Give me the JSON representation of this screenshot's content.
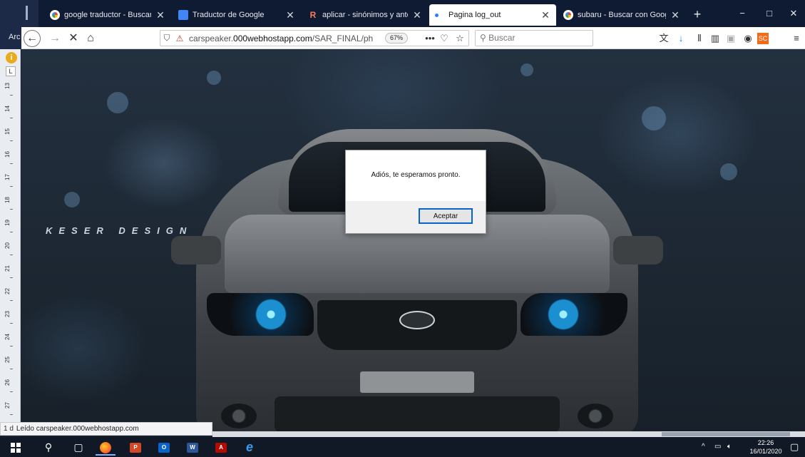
{
  "browser": {
    "tabs": [
      {
        "title": "google traductor - Buscar con Google",
        "favicon": "google-icon"
      },
      {
        "title": "Traductor de Google",
        "favicon": "translate-icon"
      },
      {
        "title": "aplicar - sinónimos y antónimos",
        "favicon": "wordreference-icon"
      },
      {
        "title": "Pagina log_out",
        "favicon": "loading-dot-icon",
        "active": true
      },
      {
        "title": "subaru - Buscar con Google",
        "favicon": "google-icon"
      }
    ],
    "new_tab": "+",
    "window_controls": {
      "minimize": "−",
      "maximize": "□",
      "close": "✕"
    },
    "left_pane_label": "Arc",
    "url_host": "carspeaker.000webhostapp.com",
    "url_prefix": "carspeaker.",
    "url_main": "000webhostapp.com",
    "url_path": "/SAR_FINAL/ph",
    "zoom": "67%",
    "search_placeholder": "Buscar",
    "more_actions": "•••"
  },
  "ruler": {
    "l_label": "L",
    "info_badge": "i",
    "numbers": [
      "13",
      "14",
      "15",
      "16",
      "17",
      "18",
      "19",
      "20",
      "21",
      "22",
      "23",
      "24",
      "25",
      "26",
      "27"
    ]
  },
  "page": {
    "brand": "KESER DESIGN"
  },
  "dialog": {
    "message": "Adiós, te esperamos pronto.",
    "ok_label": "Aceptar"
  },
  "status": {
    "prefix": "1 d",
    "text": "Leído carspeaker.000webhostapp.com"
  },
  "taskbar": {
    "time": "22:26",
    "date": "16/01/2020",
    "apps": [
      "start",
      "search",
      "task-view",
      "firefox",
      "powerpoint",
      "outlook",
      "word",
      "acrobat",
      "internet-explorer"
    ]
  },
  "colors": {
    "tabbar_bg": "#0f1b33",
    "accent_blue": "#0a64c8",
    "taskbar_bg": "#111826"
  }
}
